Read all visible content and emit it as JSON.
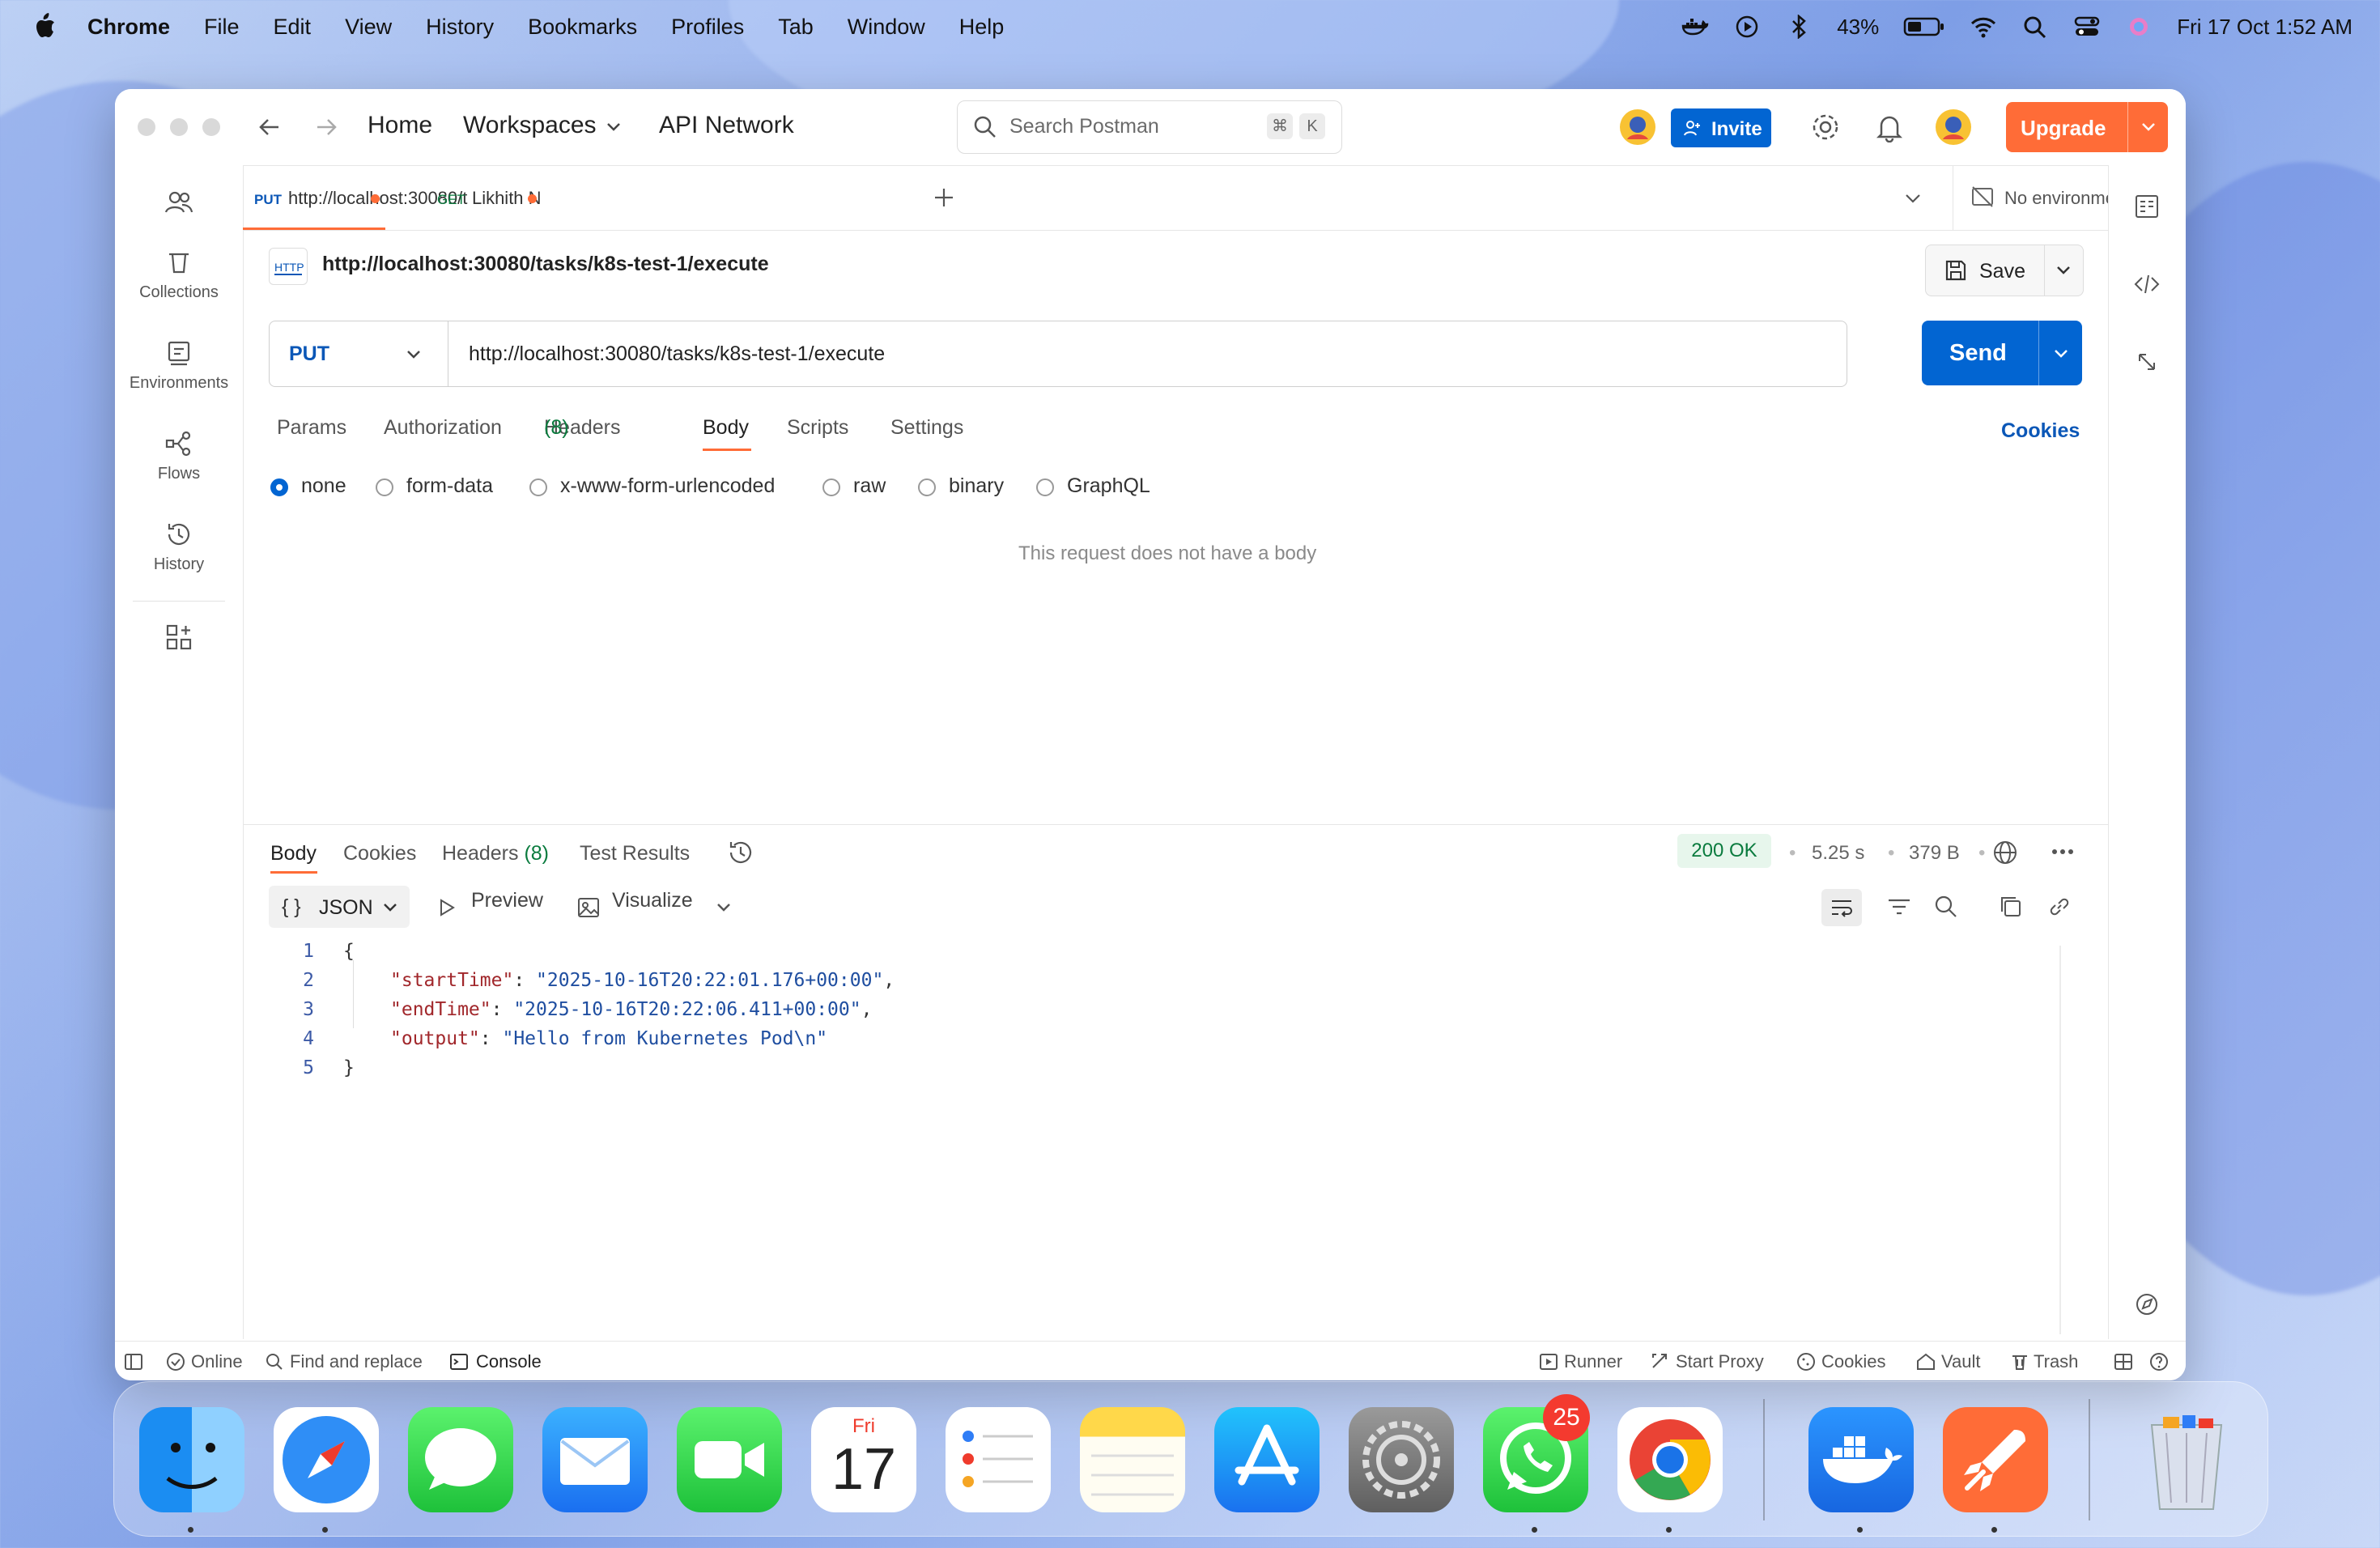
{
  "menubar": {
    "app": "Chrome",
    "items": [
      "File",
      "Edit",
      "View",
      "History",
      "Bookmarks",
      "Profiles",
      "Tab",
      "Window",
      "Help"
    ],
    "battery": "43%",
    "datetime": "Fri 17 Oct  1:52 AM"
  },
  "titlebar": {
    "home": "Home",
    "workspaces": "Workspaces",
    "api_network": "API Network",
    "search_placeholder": "Search Postman",
    "kbd_cmd": "⌘",
    "kbd_k": "K",
    "invite": "Invite",
    "upgrade": "Upgrade"
  },
  "sidebar": {
    "items": [
      {
        "label": ""
      },
      {
        "label": "Collections"
      },
      {
        "label": "Environments"
      },
      {
        "label": "Flows"
      },
      {
        "label": "History"
      }
    ]
  },
  "tabs": [
    {
      "method": "PUT",
      "title": "http://localhost:30080/t"
    },
    {
      "method": "GET",
      "title": "Likhith N"
    }
  ],
  "environment": "No environment",
  "request": {
    "crumb": "http://localhost:30080/tasks/k8s-test-1/execute",
    "http_badge": "HTTP",
    "save": "Save",
    "method": "PUT",
    "url": "http://localhost:30080/tasks/k8s-test-1/execute",
    "send": "Send",
    "tabs": {
      "params": "Params",
      "authorization": "Authorization",
      "headers": "Headers",
      "headers_count": "(8)",
      "body": "Body",
      "scripts": "Scripts",
      "settings": "Settings"
    },
    "cookies": "Cookies",
    "body_types": [
      "none",
      "form-data",
      "x-www-form-urlencoded",
      "raw",
      "binary",
      "GraphQL"
    ],
    "selected_body_type": "none",
    "no_body": "This request does not have a body"
  },
  "response": {
    "tabs": {
      "body": "Body",
      "cookies": "Cookies",
      "headers": "Headers",
      "headers_count": "(8)",
      "tests": "Test Results"
    },
    "status": "200 OK",
    "time": "5.25 s",
    "size": "379 B",
    "format": "JSON",
    "preview": "Preview",
    "visualize": "Visualize",
    "line_numbers": [
      "1",
      "2",
      "3",
      "4",
      "5"
    ],
    "json": {
      "open": "{",
      "close": "}",
      "lines": [
        {
          "key": "\"startTime\"",
          "value": "\"2025-10-16T20:22:01.176+00:00\"",
          "trail": ","
        },
        {
          "key": "\"endTime\"",
          "value": "\"2025-10-16T20:22:06.411+00:00\"",
          "trail": ","
        },
        {
          "key": "\"output\"",
          "value": "\"Hello from Kubernetes Pod\\n\"",
          "trail": ""
        }
      ]
    }
  },
  "statusbar": {
    "online": "Online",
    "find": "Find and replace",
    "console": "Console",
    "runner": "Runner",
    "proxy": "Start Proxy",
    "cookies": "Cookies",
    "vault": "Vault",
    "trash": "Trash"
  },
  "dock": {
    "calendar_day": "Fri",
    "calendar_date": "17",
    "whatsapp_badge": "25"
  },
  "colors": {
    "brand_orange": "#ff6c37",
    "send_blue": "#0265d2",
    "status_green": "#0a7b3e"
  }
}
